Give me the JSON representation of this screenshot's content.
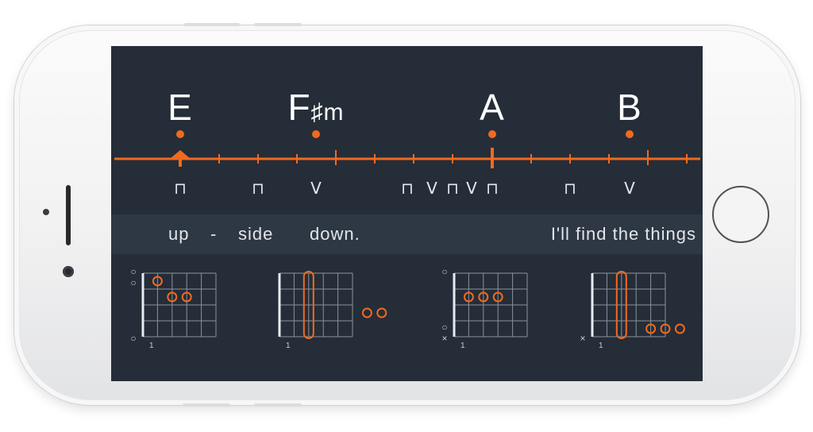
{
  "chords": [
    {
      "root": "E",
      "quality": ""
    },
    {
      "root": "F",
      "quality": "♯m"
    },
    {
      "root": "A",
      "quality": ""
    },
    {
      "root": "B",
      "quality": ""
    }
  ],
  "strums": [
    "⊓",
    "⊓",
    "V",
    "⊓",
    "V",
    "⊓",
    "V",
    "⊓",
    "⊓",
    "V"
  ],
  "lyrics": {
    "words": [
      "up",
      "-",
      "side",
      "down."
    ],
    "upcoming": "I'll  find the things"
  },
  "diagrams": [
    {
      "chord": "E",
      "fret_label": "1",
      "open_marks": [
        "○",
        "○",
        "○"
      ],
      "mute_marks": []
    },
    {
      "chord": "F#m",
      "fret_label": "1",
      "open_marks": [],
      "mute_marks": []
    },
    {
      "chord": "A",
      "fret_label": "1",
      "open_marks": [
        "○",
        "○"
      ],
      "mute_marks": [
        "×"
      ]
    },
    {
      "chord": "B",
      "fret_label": "1",
      "open_marks": [],
      "mute_marks": [
        "×"
      ]
    }
  ],
  "colors": {
    "accent": "#f06a1f",
    "screen_bg": "#252d38",
    "lyric_bar_bg": "#2e3744",
    "text": "#ffffff",
    "grid": "#8a929c"
  }
}
